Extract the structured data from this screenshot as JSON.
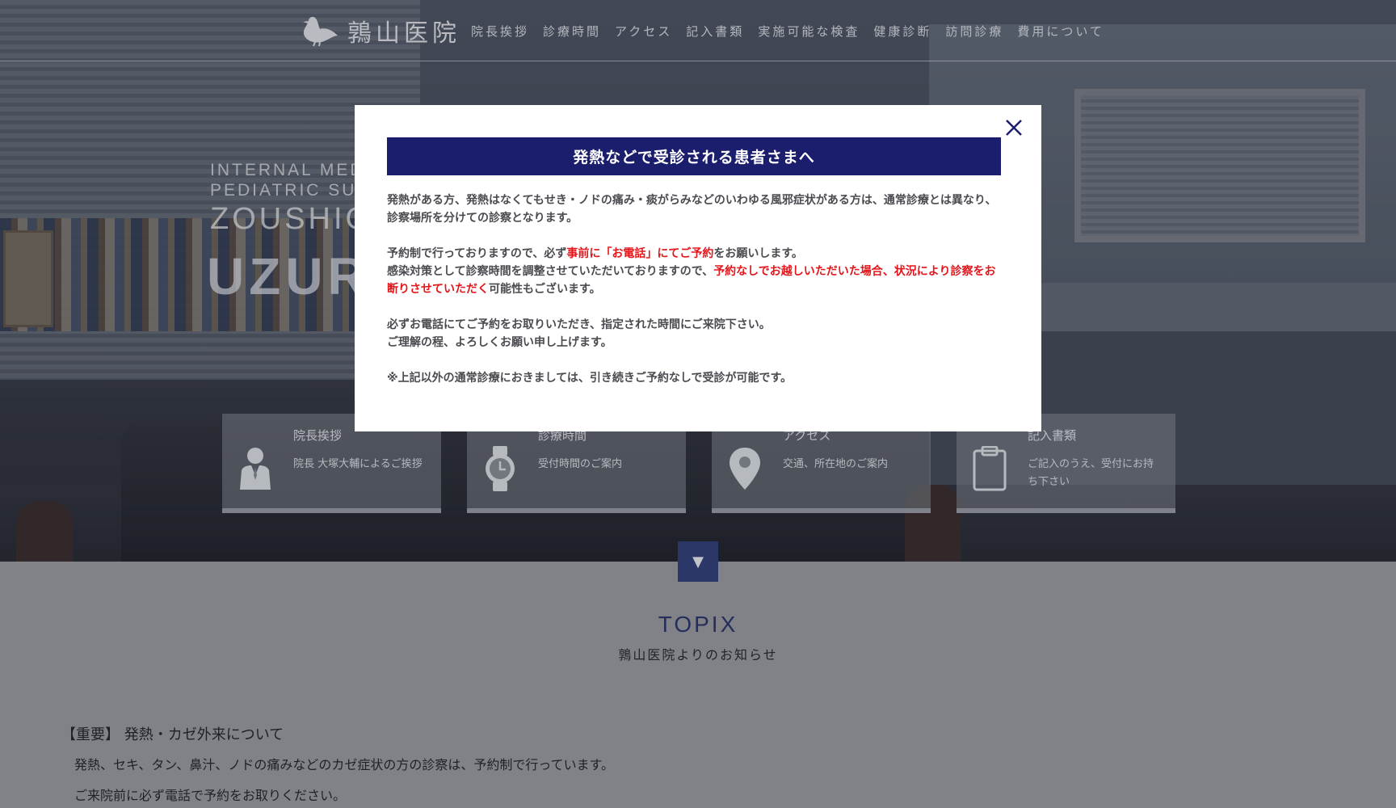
{
  "header": {
    "logo_text": "鶉山医院",
    "nav": [
      "院長挨拶",
      "診療時間",
      "アクセス",
      "記入書類",
      "実施可能な検査",
      "健康診断",
      "訪問診療",
      "費用について"
    ]
  },
  "hero": {
    "sub_line_1": "INTERNAL MEDIC",
    "sub_line_2": "PEDIATRIC SURG",
    "brand": "ZOUSHIG",
    "title": "UZURA"
  },
  "cards": [
    {
      "title": "院長挨拶",
      "desc": "院長 大塚大輔によるご挨拶",
      "icon": "person-icon"
    },
    {
      "title": "診療時間",
      "desc": "受付時間のご案内",
      "icon": "watch-icon"
    },
    {
      "title": "アクセス",
      "desc": "交通、所在地のご案内",
      "icon": "map-pin-icon"
    },
    {
      "title": "記入書類",
      "desc": "ご記入のうえ、受付にお持ち下さい",
      "icon": "clipboard-icon"
    }
  ],
  "scroll_button": "▼",
  "topix": {
    "heading": "TOPIX",
    "subheading": "鶉山医院よりのお知らせ",
    "news_title": "【重要】 発熱・カゼ外来について",
    "news_line_1": "発熱、セキ、タン、鼻汁、ノドの痛みなどのカゼ症状の方の診察は、予約制で行っています。",
    "news_line_2": "ご来院前に必ず電話で予約をお取りください。"
  },
  "modal": {
    "title": "発熱などで受診される患者さまへ",
    "p1": "発熱がある方、発熱はなくてもせき・ノドの痛み・痰がらみなどのいわゆる風邪症状がある方は、通常診療とは異なり、診察場所を分けての診察となります。",
    "p2_a": "予約制で行っておりますので、必ず",
    "p2_red": "事前に「お電話」にてご予約",
    "p2_b": "をお願いします。",
    "p2_c": "感染対策として診察時間を調整させていただいておりますので、",
    "p2_red2": "予約なしでお越しいただいた場合、状況により診察をお断りさせていただく",
    "p2_d": "可能性もございます。",
    "p3_a": "必ずお電話にてご予約をお取りいただき、指定された時間にご来院下さい。",
    "p3_b": "ご理解の程、よろしくお願い申し上げます。",
    "p4": "※上記以外の通常診療におきましては、引き続きご予約なしで受診が可能です。"
  },
  "colors": {
    "modal_header_bg": "#1b1d6d",
    "warning_red": "#e3161c",
    "scroll_button_bg": "#2d3c7a",
    "topix_heading": "#24306a"
  }
}
